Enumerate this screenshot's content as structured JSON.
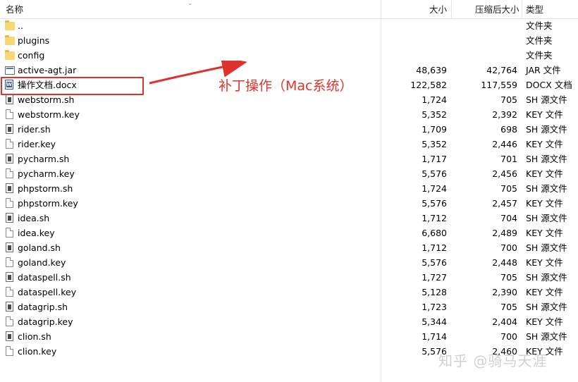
{
  "columns": {
    "name": "名称",
    "size": "大小",
    "compressed": "压缩后大小",
    "type": "类型"
  },
  "files": [
    {
      "name": "..",
      "icon": "folder-icon",
      "size": "",
      "compressed": "",
      "type": "文件夹"
    },
    {
      "name": "plugins",
      "icon": "folder-icon",
      "size": "",
      "compressed": "",
      "type": "文件夹"
    },
    {
      "name": "config",
      "icon": "folder-icon",
      "size": "",
      "compressed": "",
      "type": "文件夹"
    },
    {
      "name": "active-agt.jar",
      "icon": "jar-file-icon",
      "size": "48,639",
      "compressed": "42,764",
      "type": "JAR 文件"
    },
    {
      "name": "操作文档.docx",
      "icon": "word-doc-icon",
      "size": "122,582",
      "compressed": "117,559",
      "type": "DOCX 文档"
    },
    {
      "name": "webstorm.sh",
      "icon": "shell-script-icon",
      "size": "1,724",
      "compressed": "705",
      "type": "SH 源文件"
    },
    {
      "name": "webstorm.key",
      "icon": "key-file-icon",
      "size": "5,352",
      "compressed": "2,392",
      "type": "KEY 文件"
    },
    {
      "name": "rider.sh",
      "icon": "shell-script-icon",
      "size": "1,709",
      "compressed": "698",
      "type": "SH 源文件"
    },
    {
      "name": "rider.key",
      "icon": "key-file-icon",
      "size": "5,352",
      "compressed": "2,446",
      "type": "KEY 文件"
    },
    {
      "name": "pycharm.sh",
      "icon": "shell-script-icon",
      "size": "1,717",
      "compressed": "701",
      "type": "SH 源文件"
    },
    {
      "name": "pycharm.key",
      "icon": "key-file-icon",
      "size": "5,576",
      "compressed": "2,456",
      "type": "KEY 文件"
    },
    {
      "name": "phpstorm.sh",
      "icon": "shell-script-icon",
      "size": "1,724",
      "compressed": "705",
      "type": "SH 源文件"
    },
    {
      "name": "phpstorm.key",
      "icon": "key-file-icon",
      "size": "5,576",
      "compressed": "2,457",
      "type": "KEY 文件"
    },
    {
      "name": "idea.sh",
      "icon": "shell-script-icon",
      "size": "1,712",
      "compressed": "704",
      "type": "SH 源文件"
    },
    {
      "name": "idea.key",
      "icon": "key-file-icon",
      "size": "6,680",
      "compressed": "2,489",
      "type": "KEY 文件"
    },
    {
      "name": "goland.sh",
      "icon": "shell-script-icon",
      "size": "1,712",
      "compressed": "700",
      "type": "SH 源文件"
    },
    {
      "name": "goland.key",
      "icon": "key-file-icon",
      "size": "5,576",
      "compressed": "2,448",
      "type": "KEY 文件"
    },
    {
      "name": "dataspell.sh",
      "icon": "shell-script-icon",
      "size": "1,727",
      "compressed": "705",
      "type": "SH 源文件"
    },
    {
      "name": "dataspell.key",
      "icon": "key-file-icon",
      "size": "5,128",
      "compressed": "2,390",
      "type": "KEY 文件"
    },
    {
      "name": "datagrip.sh",
      "icon": "shell-script-icon",
      "size": "1,723",
      "compressed": "705",
      "type": "SH 源文件"
    },
    {
      "name": "datagrip.key",
      "icon": "key-file-icon",
      "size": "5,344",
      "compressed": "2,404",
      "type": "KEY 文件"
    },
    {
      "name": "clion.sh",
      "icon": "shell-script-icon",
      "size": "1,714",
      "compressed": "700",
      "type": "SH 源文件"
    },
    {
      "name": "clion.key",
      "icon": "key-file-icon",
      "size": "5,576",
      "compressed": "2,460",
      "type": "KEY 文件"
    }
  ],
  "annotation": {
    "text": "补丁操作（Mac系统）",
    "color": "#e0322d"
  },
  "watermark": "知乎 @骑马天涯"
}
